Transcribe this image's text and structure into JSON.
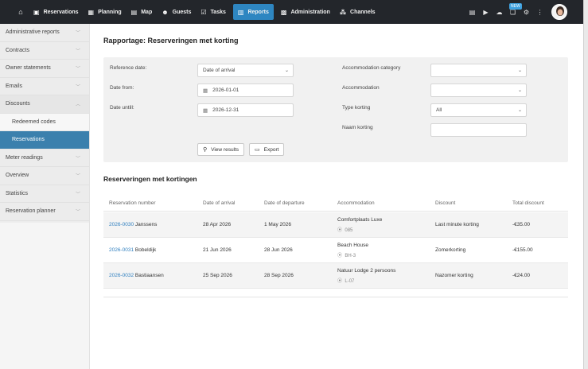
{
  "topnav": {
    "items": [
      {
        "icon": "reservations-icon",
        "label": "Reservations"
      },
      {
        "icon": "planning-icon",
        "label": "Planning"
      },
      {
        "icon": "map-icon",
        "label": "Map"
      },
      {
        "icon": "guests-icon",
        "label": "Guests"
      },
      {
        "icon": "tasks-icon",
        "label": "Tasks"
      },
      {
        "icon": "reports-icon",
        "label": "Reports",
        "active": true
      },
      {
        "icon": "administration-icon",
        "label": "Administration"
      },
      {
        "icon": "channels-icon",
        "label": "Channels"
      }
    ],
    "badge": "NEW"
  },
  "sidebar": {
    "items": [
      {
        "label": "Administrative reports"
      },
      {
        "label": "Contracts"
      },
      {
        "label": "Owner statements"
      },
      {
        "label": "Emails"
      },
      {
        "label": "Discounts",
        "open": true
      },
      {
        "label": "Meter readings"
      },
      {
        "label": "Overview"
      },
      {
        "label": "Statistics"
      },
      {
        "label": "Reservation planner"
      }
    ],
    "sub_items": [
      {
        "label": "Redeemed codes"
      },
      {
        "label": "Reservations",
        "active": true
      }
    ]
  },
  "page": {
    "title": "Rapportage: Reserveringen met korting"
  },
  "filters": {
    "reference_date_label": "Reference date:",
    "reference_date_value": "Date of arrival",
    "date_from_label": "Date from:",
    "date_from_value": "2026-01-01",
    "date_until_label": "Date untill:",
    "date_until_value": "2026-12-31",
    "accommodation_category_label": "Accommodation category",
    "accommodation_category_value": "",
    "accommodation_label": "Accommodation",
    "accommodation_value": "",
    "type_korting_label": "Type korting",
    "type_korting_value": "All",
    "naam_korting_label": "Naam korting",
    "naam_korting_value": "",
    "view_results_label": "View results",
    "export_label": "Export"
  },
  "results": {
    "title": "Reserveringen met kortingen",
    "columns": [
      "Reservation number",
      "Date of arrival",
      "Date of departure",
      "Accommodation",
      "Discount",
      "Total discount"
    ],
    "rows": [
      {
        "number": "2026-0030",
        "name": "Janssens",
        "arrival": "28 Apr 2026",
        "departure": "1 May 2026",
        "accommodation": "Comfortplaats Luxe",
        "code": "085",
        "discount": "Last minute korting",
        "total": "-€35.00"
      },
      {
        "number": "2026-0031",
        "name": "Bobeldijk",
        "arrival": "21 Jun 2026",
        "departure": "28 Jun 2026",
        "accommodation": "Beach House",
        "code": "BH-3",
        "discount": "Zomerkorting",
        "total": "-€155.00"
      },
      {
        "number": "2026-0032",
        "name": "Bastiaansen",
        "arrival": "25 Sep 2026",
        "departure": "28 Sep 2026",
        "accommodation": "Natuur Lodge 2 persoons",
        "code": "L-07",
        "discount": "Nazomer korting",
        "total": "-€24.00"
      }
    ]
  },
  "colors": {
    "topbar": "#23262b",
    "accent": "#2e86c1",
    "sidebar_active": "#3b80ad",
    "link": "#2f7fbf"
  }
}
